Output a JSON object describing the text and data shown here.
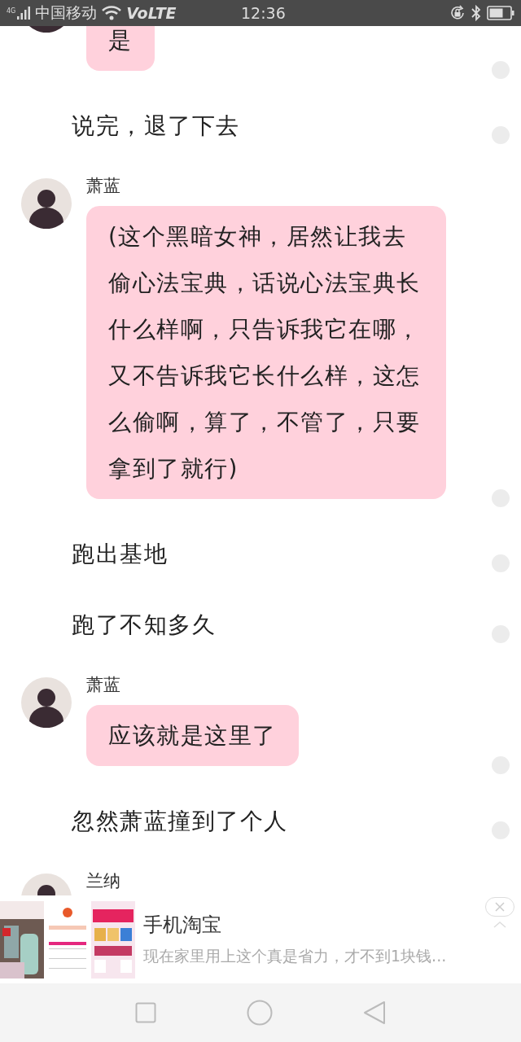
{
  "status_bar": {
    "network": "4G",
    "carrier": "中国移动",
    "volte": "VoLTE",
    "time": "12:36"
  },
  "messages": [
    {
      "kind": "bubble",
      "text": "是"
    },
    {
      "kind": "narration",
      "text": "说完，退了下去"
    },
    {
      "kind": "bubble",
      "speaker": "萧蓝",
      "text": "(这个黑暗女神，居然让我去偷心法宝典，话说心法宝典长什么样啊，只告诉我它在哪，又不告诉我它长什么样，这怎么偷啊，算了，不管了，只要拿到了就行)"
    },
    {
      "kind": "narration",
      "text": "跑出基地"
    },
    {
      "kind": "narration",
      "text": "跑了不知多久"
    },
    {
      "kind": "bubble",
      "speaker": "萧蓝",
      "text": "应该就是这里了"
    },
    {
      "kind": "narration",
      "text": "忽然萧蓝撞到了个人"
    },
    {
      "kind": "bubble",
      "speaker": "兰纳"
    }
  ],
  "ad": {
    "title": "手机淘宝",
    "description": "现在家里用上这个真是省力，才不到1块钱..."
  }
}
